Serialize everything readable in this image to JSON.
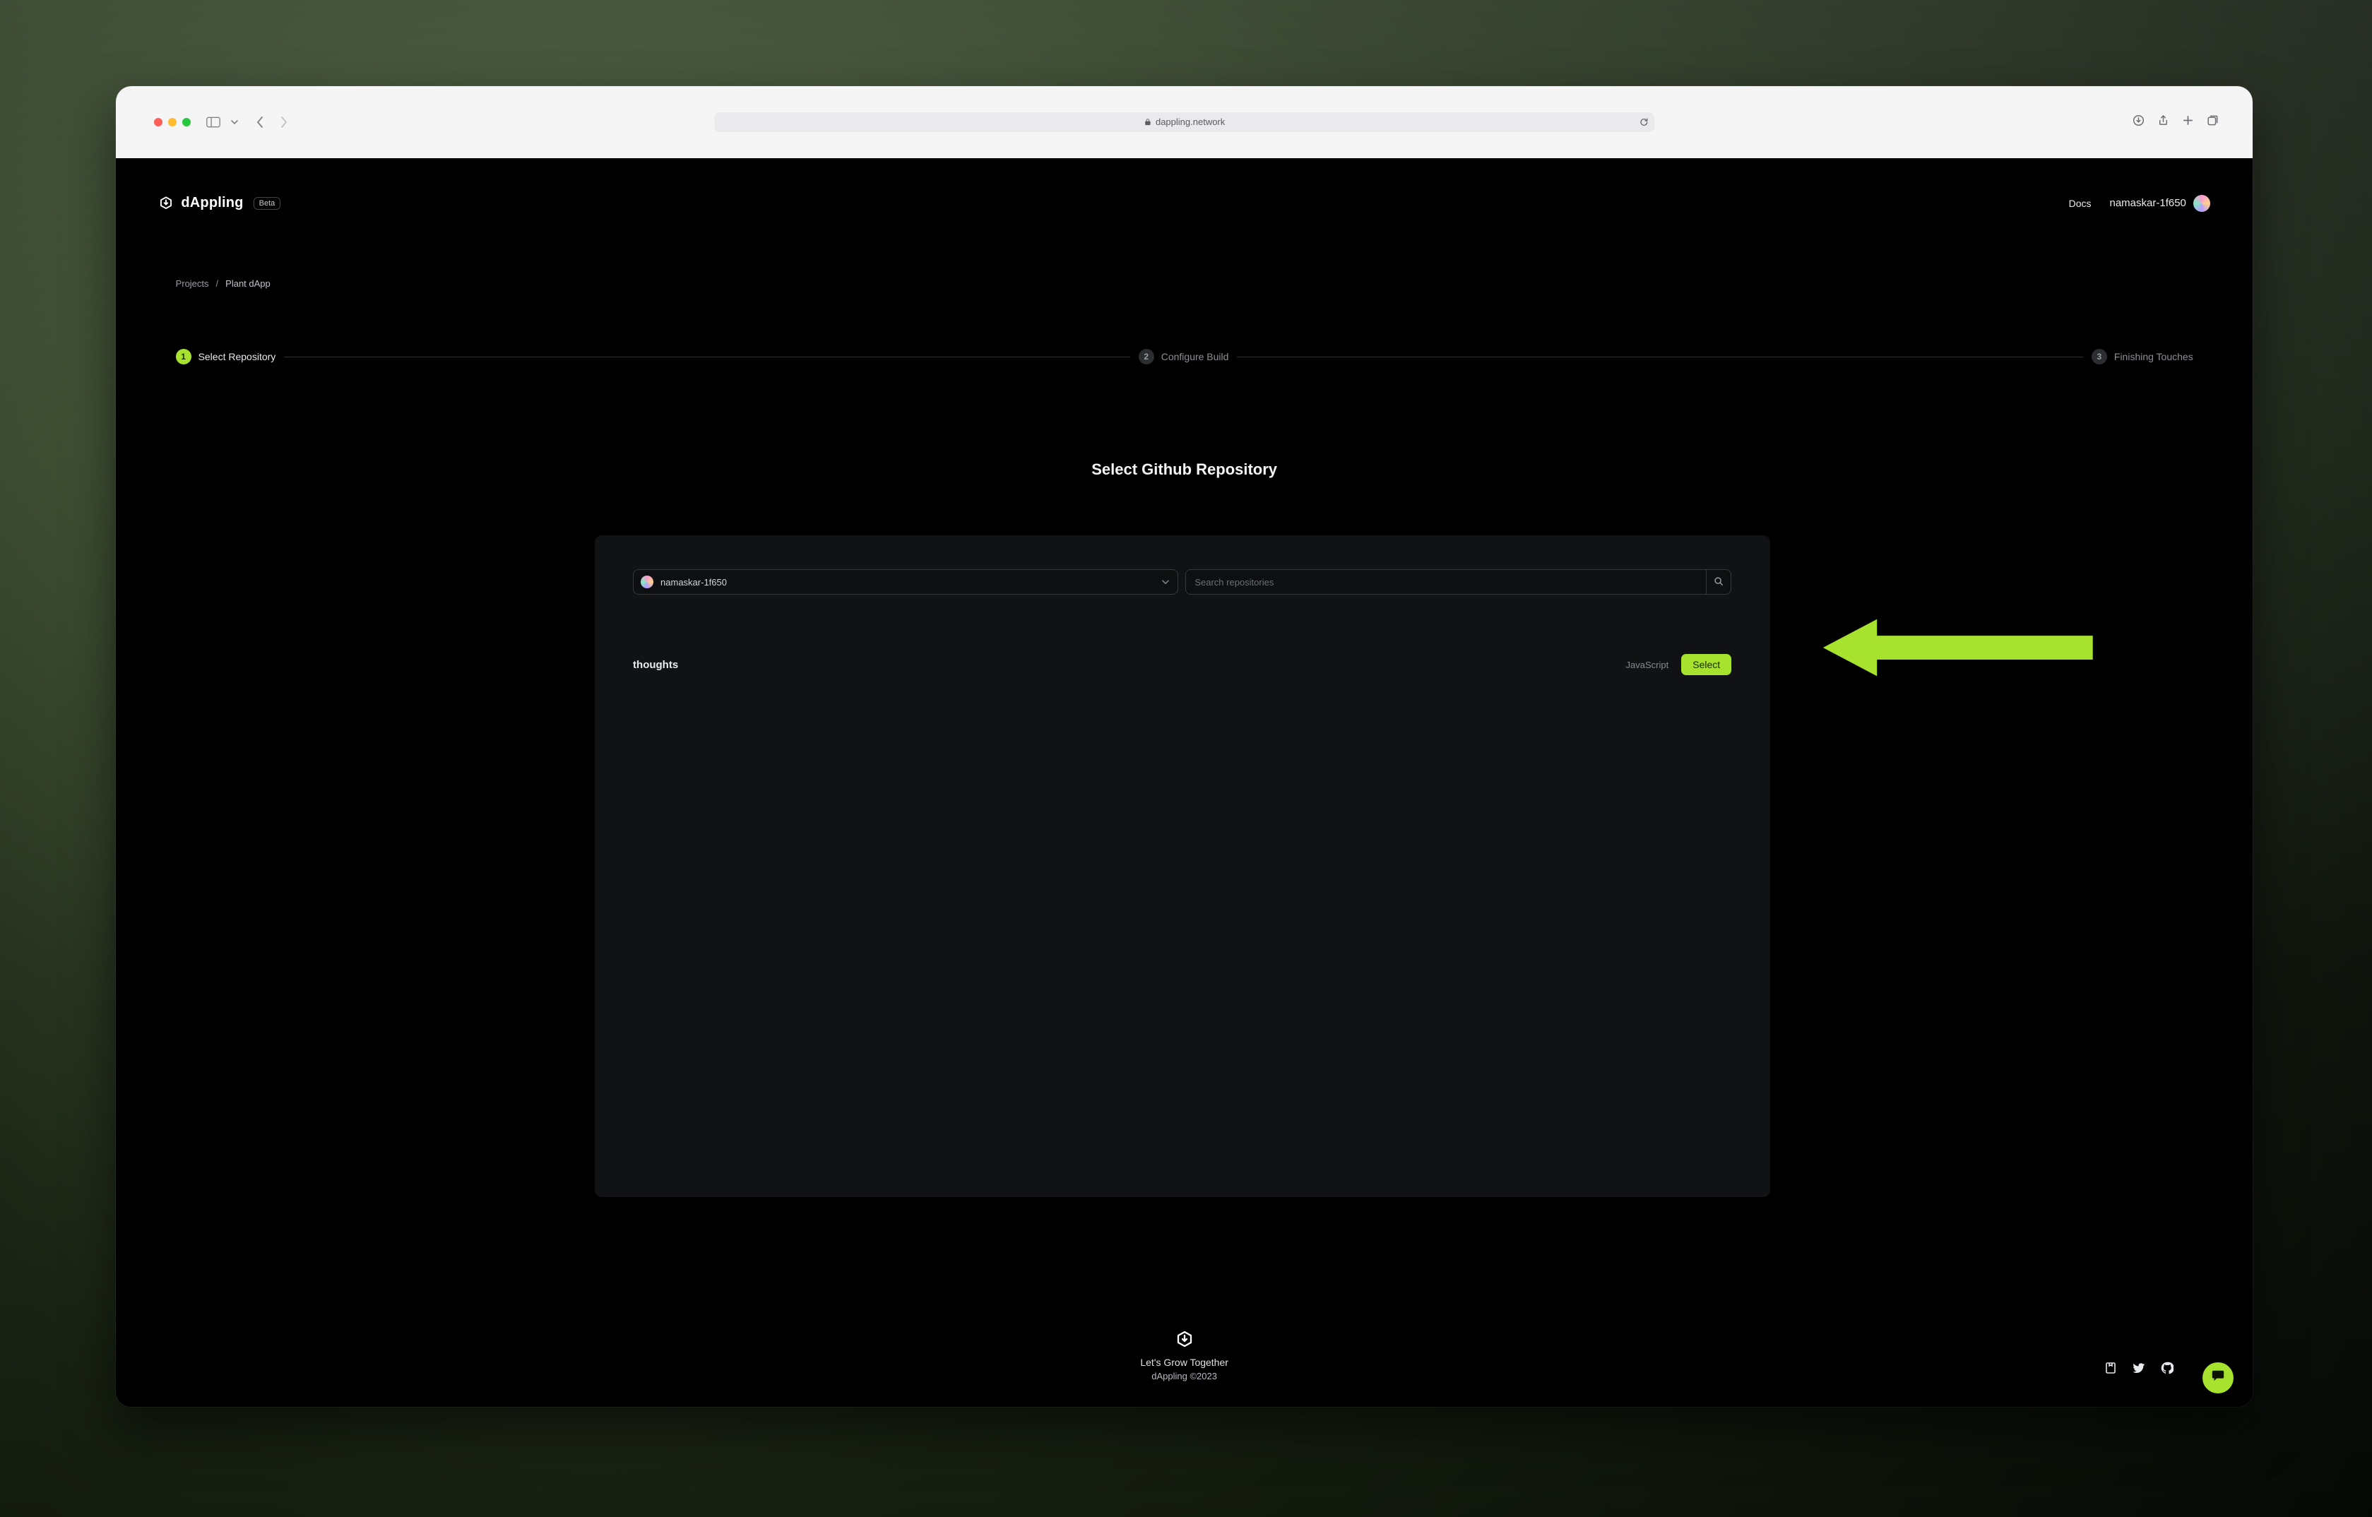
{
  "browser": {
    "url_display": "dappling.network"
  },
  "appbar": {
    "brand": "dAppling",
    "badge": "Beta",
    "nav_docs": "Docs",
    "username": "namaskar-1f650"
  },
  "breadcrumb": {
    "root": "Projects",
    "current": "Plant dApp",
    "separator": "/"
  },
  "stepper": {
    "steps": [
      {
        "num": "1",
        "label": "Select Repository",
        "active": true
      },
      {
        "num": "2",
        "label": "Configure Build",
        "active": false
      },
      {
        "num": "3",
        "label": "Finishing Touches",
        "active": false
      }
    ]
  },
  "section": {
    "title": "Select Github Repository"
  },
  "org_select": {
    "value": "namaskar-1f650"
  },
  "search": {
    "placeholder": "Search repositories"
  },
  "repos": [
    {
      "name": "thoughts",
      "language": "JavaScript",
      "select_label": "Select"
    }
  ],
  "footer": {
    "tagline": "Let's Grow Together",
    "copyright": "dAppling ©2023"
  },
  "colors": {
    "accent": "#a6e22e",
    "panel": "#111214",
    "border": "#35383c"
  }
}
